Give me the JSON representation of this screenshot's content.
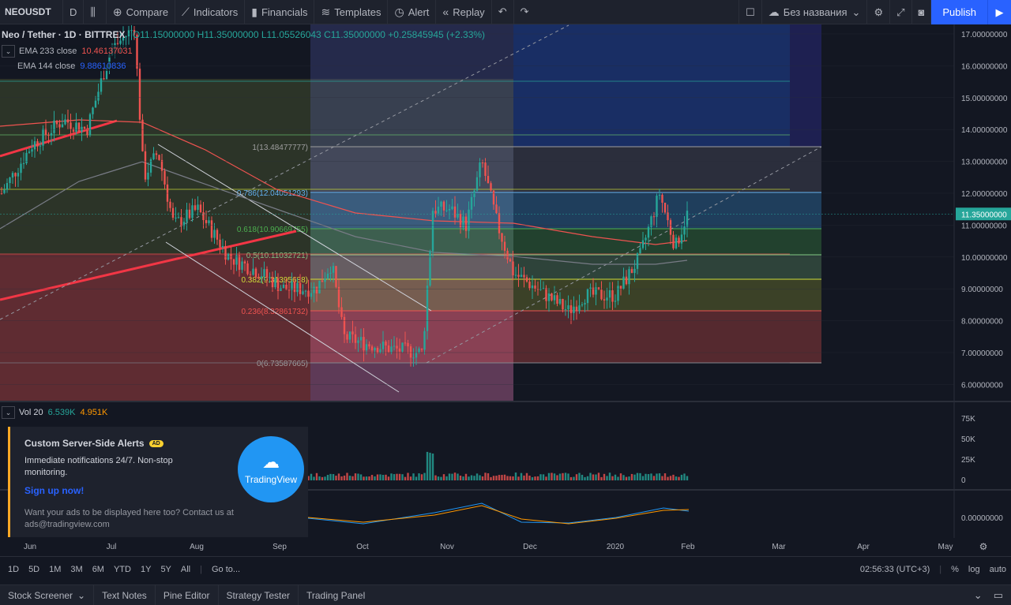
{
  "toolbar": {
    "symbol": "NEOUSDT",
    "interval": "D",
    "compare": "Compare",
    "indicators": "Indicators",
    "financials": "Financials",
    "templates": "Templates",
    "alert": "Alert",
    "replay": "Replay",
    "layout_name": "Без названия",
    "publish": "Publish"
  },
  "legend": {
    "title": "Neo / Tether · 1D · BITTREX",
    "o": "O11.15000000",
    "h": "H11.35000000",
    "l": "L11.05526043",
    "c": "C11.35000000",
    "change": "+0.25845945 (+2.33%)",
    "ema233_label": "EMA 233 close",
    "ema233_value": "10.46137031",
    "ema144_label": "EMA 144 close",
    "ema144_value": "9.88610836"
  },
  "volume": {
    "label": "Vol 20",
    "v1": "6.539K",
    "v2": "4.951K",
    "axis": [
      "75K",
      "50K",
      "25K",
      "0"
    ]
  },
  "macd_axis": "0.00000000",
  "price_axis": [
    "17.00000000",
    "16.00000000",
    "15.00000000",
    "14.00000000",
    "13.00000000",
    "12.00000000",
    "11.00000000",
    "10.00000000",
    "9.00000000",
    "8.00000000",
    "7.00000000",
    "6.00000000"
  ],
  "last_price": "11.35000000",
  "fib_levels": [
    {
      "label": "1(13.48477777)",
      "color": "#9e9e9e"
    },
    {
      "label": "0.786(12.04051293)",
      "color": "#64b5f6"
    },
    {
      "label": "0.618(10.90669755)",
      "color": "#4caf50"
    },
    {
      "label": "0.5(10.11032721)",
      "color": "#81c784"
    },
    {
      "label": "0.382(9.31395688)",
      "color": "#cddc39"
    },
    {
      "label": "0.236(8.32861732)",
      "color": "#ef5350"
    },
    {
      "label": "0(6.73587665)",
      "color": "#9e9e9e"
    }
  ],
  "time_axis": [
    "Jun",
    "Jul",
    "Aug",
    "Sep",
    "Oct",
    "Nov",
    "Dec",
    "2020",
    "Feb",
    "Mar",
    "Apr",
    "May"
  ],
  "ad": {
    "title": "Custom Server-Side Alerts",
    "badge": "AD",
    "desc": "Immediate notifications 24/7. Non-stop monitoring.",
    "link": "Sign up now!",
    "footer": "Want your ads to be displayed here too? Contact us at ads@tradingview.com",
    "logo": "TradingView"
  },
  "ranges": [
    "1D",
    "5D",
    "1M",
    "3M",
    "6M",
    "YTD",
    "1Y",
    "5Y",
    "All"
  ],
  "goto": "Go to...",
  "clock": "02:56:33 (UTC+3)",
  "scale_opts": [
    "%",
    "log",
    "auto"
  ],
  "panels": [
    "Stock Screener",
    "Text Notes",
    "Pine Editor",
    "Strategy Tester",
    "Trading Panel"
  ],
  "colors": {
    "up": "#26a69a",
    "down": "#ef5350",
    "accent": "#2962ff"
  }
}
